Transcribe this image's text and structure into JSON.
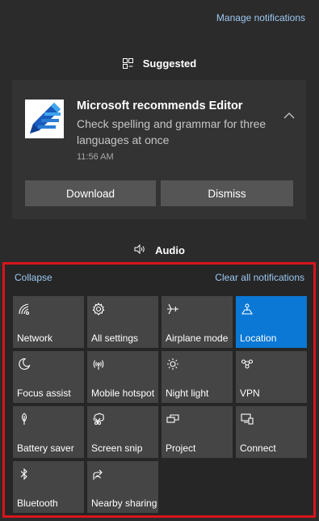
{
  "header": {
    "manage_label": "Manage notifications"
  },
  "suggested": {
    "label": "Suggested"
  },
  "toast": {
    "title": "Microsoft recommends Editor",
    "body": "Check spelling and grammar for three languages at once",
    "time": "11:56 AM",
    "download_label": "Download",
    "dismiss_label": "Dismiss"
  },
  "audio": {
    "label": "Audio"
  },
  "action_center": {
    "collapse_label": "Collapse",
    "clear_label": "Clear all notifications",
    "tiles": [
      {
        "label": "Network",
        "icon": "network-icon",
        "active": false
      },
      {
        "label": "All settings",
        "icon": "gear-icon",
        "active": false
      },
      {
        "label": "Airplane mode",
        "icon": "airplane-icon",
        "active": false
      },
      {
        "label": "Location",
        "icon": "location-icon",
        "active": true
      },
      {
        "label": "Focus assist",
        "icon": "moon-icon",
        "active": false
      },
      {
        "label": "Mobile hotspot",
        "icon": "hotspot-icon",
        "active": false
      },
      {
        "label": "Night light",
        "icon": "brightness-icon",
        "active": false
      },
      {
        "label": "VPN",
        "icon": "vpn-icon",
        "active": false
      },
      {
        "label": "Battery saver",
        "icon": "leaf-icon",
        "active": false
      },
      {
        "label": "Screen snip",
        "icon": "scissors-icon",
        "active": false
      },
      {
        "label": "Project",
        "icon": "project-icon",
        "active": false
      },
      {
        "label": "Connect",
        "icon": "connect-icon",
        "active": false
      },
      {
        "label": "Bluetooth",
        "icon": "bluetooth-icon",
        "active": false
      },
      {
        "label": "Nearby sharing",
        "icon": "share-icon",
        "active": false
      }
    ]
  },
  "colors": {
    "accent": "#0a78d4",
    "highlight_border": "#d8141c",
    "link": "#9cc8f0"
  }
}
